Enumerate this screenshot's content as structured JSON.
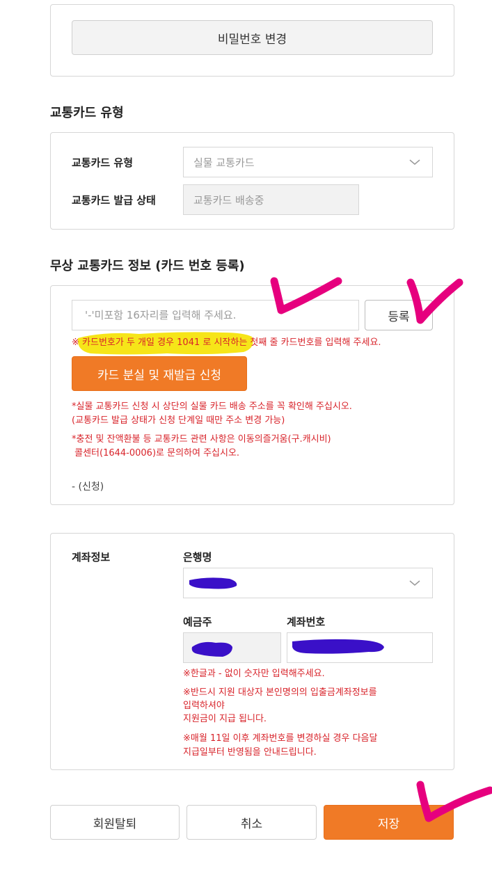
{
  "password": {
    "change_button": "비밀번호 변경"
  },
  "card_type_section": {
    "title": "교통카드 유형",
    "type_label": "교통카드 유형",
    "type_value": "실물 교통카드",
    "status_label": "교통카드 발급 상태",
    "status_value": "교통카드 배송중"
  },
  "free_card_section": {
    "title": "무상 교통카드 정보 (카드 번호 등록)",
    "card_input_placeholder": "'-'미포함 16자리를 입력해 주세요.",
    "register_button": "등록",
    "notice_card_number": "※ 카드번호가 두 개일 경우 1041 로 시작하는 첫째 줄 카드번호를 입력해 주세요.",
    "reissue_button": "카드 분실 및 재발급 신청",
    "notice_address_1": "*실물 교통카드 신청 시 상단의 실물 카드 배송 주소를 꼭 확인해 주십시오.",
    "notice_address_2": "(교통카드 발급 상태가 신청 단계일 때만 주소 변경 가능)",
    "notice_inquiry_1": "*충전 및 잔액환불 등 교통카드 관련 사항은 이동의즐거움(구.캐시비)",
    "notice_inquiry_2": " 콜센터(1644-0006)로 문의하여 주십시오.",
    "status_line": "- (신청)"
  },
  "account_section": {
    "label": "계좌정보",
    "bank_label": "은행명",
    "holder_label": "예금주",
    "account_number_label": "계좌번호",
    "note_digits": "※한글과 - 없이 숫자만 입력해주세요.",
    "note_own_account_1": "※반드시 지원 대상자 본인명의의 입출금계좌정보를",
    "note_own_account_2": "입력하셔야",
    "note_own_account_3": "지원금이 지급 됩니다.",
    "note_change_1": "※매월 11일 이후 계좌번호를 변경하실 경우 다음달",
    "note_change_2": "지급일부터 반영됨을 안내드립니다."
  },
  "footer": {
    "withdraw_button": "회원탈퇴",
    "cancel_button": "취소",
    "save_button": "저장"
  },
  "colors": {
    "accent_orange": "#f07a26",
    "notice_red": "#d8232a",
    "highlight_yellow": "#f5e200",
    "check_mark_magenta": "#e6007e",
    "redaction_blue": "#3a10c8"
  }
}
